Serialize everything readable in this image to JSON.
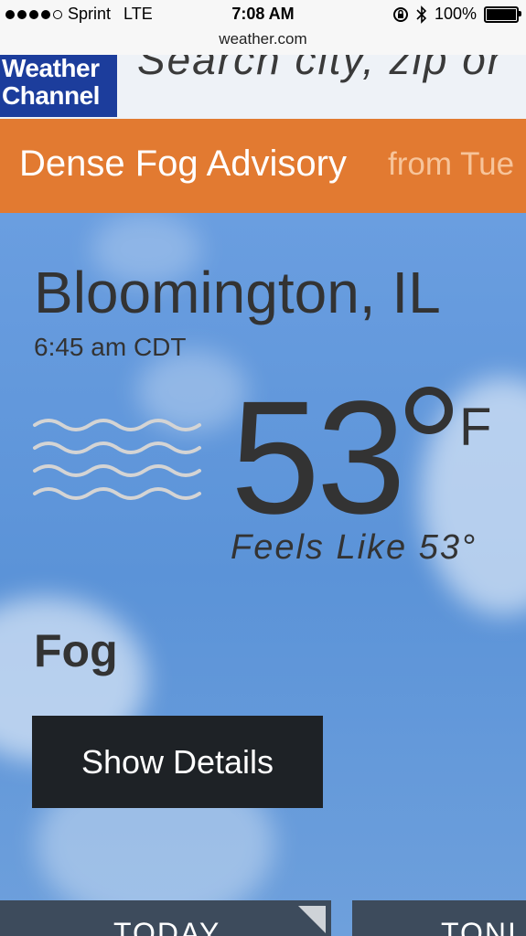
{
  "status_bar": {
    "carrier": "Sprint",
    "network": "LTE",
    "time": "7:08 AM",
    "battery": "100%",
    "url": "weather.com"
  },
  "header": {
    "logo_line1": "Weather",
    "logo_line2": "Channel",
    "search_placeholder": "Search city, zip or"
  },
  "advisory": {
    "title": "Dense Fog Advisory",
    "subtitle": "from Tue"
  },
  "current": {
    "location": "Bloomington, IL",
    "observed_time": "6:45 am CDT",
    "temperature": "53",
    "unit": "F",
    "feels_like": "Feels Like 53°",
    "condition": "Fog",
    "details_button": "Show Details",
    "icon": "fog-icon"
  },
  "tabs": [
    {
      "label": "TODAY"
    },
    {
      "label": "TONI"
    }
  ],
  "colors": {
    "advisory_bg": "#e27a31",
    "logo_bg": "#1c3d9c",
    "button_bg": "#1e2226",
    "tab_bg": "#3d4b5c"
  }
}
